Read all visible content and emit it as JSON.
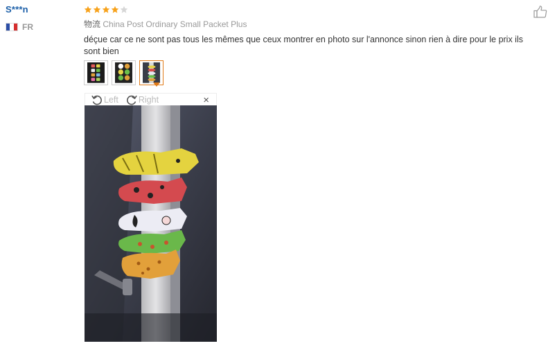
{
  "review": {
    "username": "S***n",
    "country_code": "FR",
    "rating": 4,
    "rating_max": 5,
    "shipping_label": "物流",
    "shipping_method": "China Post Ordinary Small Packet Plus",
    "comment": "déçue car ce ne sont pas tous les mêmes que ceux montrer en photo sur l'annonce sinon rien à dire pour le prix ils sont bien"
  },
  "viewer": {
    "rotate_left_label": "Left",
    "rotate_right_label": "Right",
    "close_symbol": "×"
  },
  "thumbnails": [
    {
      "name": "photo-thumbnail-1",
      "active": false
    },
    {
      "name": "photo-thumbnail-2",
      "active": false
    },
    {
      "name": "photo-thumbnail-3",
      "active": true
    }
  ],
  "colors": {
    "username": "#1a5ea8",
    "star_filled": "#f7a21b",
    "star_empty": "#d6d6d6",
    "active_thumb": "#e07a18"
  },
  "icons": {
    "flag": "france-flag-icon",
    "like": "thumbs-up-icon",
    "rotate_left": "rotate-left-icon",
    "rotate_right": "rotate-right-icon",
    "close": "close-icon"
  }
}
